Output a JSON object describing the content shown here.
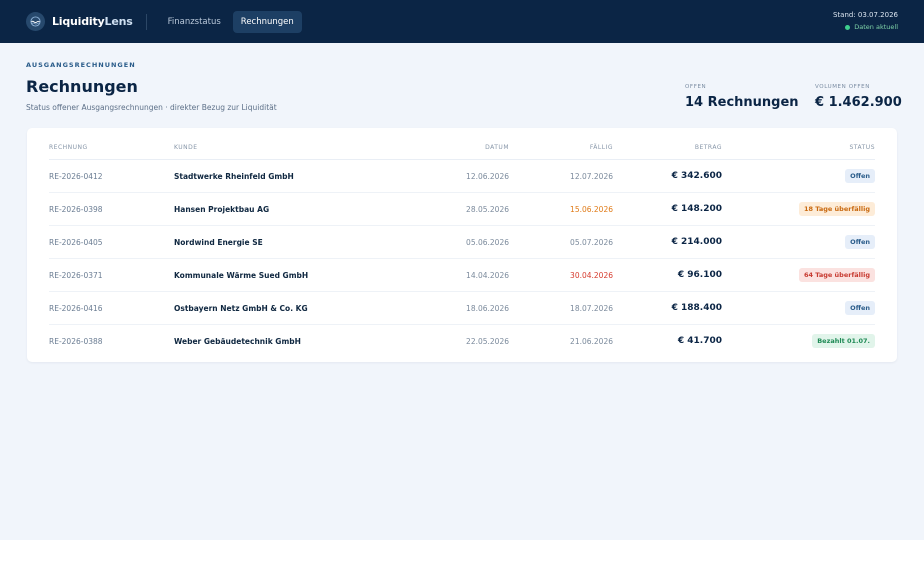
{
  "app": {
    "brand_part1": "Liquidity",
    "brand_part2": "Lens",
    "nav": [
      {
        "label": "Finanzstatus",
        "active": false
      },
      {
        "label": "Rechnungen",
        "active": true
      }
    ],
    "stand": "Stand: 03.07.2026",
    "status": "Daten aktuell"
  },
  "page": {
    "eyebrow": "AUSGANGSRECHNUNGEN",
    "title": "Rechnungen",
    "subtitle": "Status offener Ausgangsrechnungen · direkter Bezug zur Liquidität"
  },
  "kpis": [
    {
      "label": "OFFEN",
      "value": "14 Rechnungen"
    },
    {
      "label": "VOLUMEN OFFEN",
      "value": "€ 1.462.900"
    }
  ],
  "table": {
    "headers": [
      "RECHNUNG",
      "KUNDE",
      "DATUM",
      "FÄLLIG",
      "BETRAG",
      "STATUS"
    ],
    "rows": [
      {
        "nr": "RE-2026-0412",
        "kunde": "Stadtwerke Rheinfeld GmbH",
        "datum": "12.06.2026",
        "faellig": "12.07.2026",
        "faellig_state": "normal",
        "betrag": "€ 342.600",
        "status": "Offen",
        "status_type": "offen"
      },
      {
        "nr": "RE-2026-0398",
        "kunde": "Hansen Projektbau AG",
        "datum": "28.05.2026",
        "faellig": "15.06.2026",
        "faellig_state": "warn",
        "betrag": "€ 148.200",
        "status": "18 Tage überfällig",
        "status_type": "warn"
      },
      {
        "nr": "RE-2026-0405",
        "kunde": "Nordwind Energie SE",
        "datum": "05.06.2026",
        "faellig": "05.07.2026",
        "faellig_state": "normal",
        "betrag": "€ 214.000",
        "status": "Offen",
        "status_type": "offen"
      },
      {
        "nr": "RE-2026-0371",
        "kunde": "Kommunale Wärme Sued GmbH",
        "datum": "14.04.2026",
        "faellig": "30.04.2026",
        "faellig_state": "danger",
        "betrag": "€ 96.100",
        "status": "64 Tage überfällig",
        "status_type": "danger"
      },
      {
        "nr": "RE-2026-0416",
        "kunde": "Ostbayern Netz GmbH & Co. KG",
        "datum": "18.06.2026",
        "faellig": "18.07.2026",
        "faellig_state": "normal",
        "betrag": "€ 188.400",
        "status": "Offen",
        "status_type": "offen"
      },
      {
        "nr": "RE-2026-0388",
        "kunde": "Weber Gebäudetechnik GmbH",
        "datum": "22.05.2026",
        "faellig": "21.06.2026",
        "faellig_state": "normal",
        "betrag": "€ 41.700",
        "status": "Bezahlt 01.07.",
        "status_type": "paid"
      }
    ]
  },
  "colors": {
    "header_bg": "#0b2545",
    "page_bg": "#f1f5fb",
    "warn": "#e07b18",
    "danger": "#d63b2e",
    "paid": "#1f8a55"
  }
}
